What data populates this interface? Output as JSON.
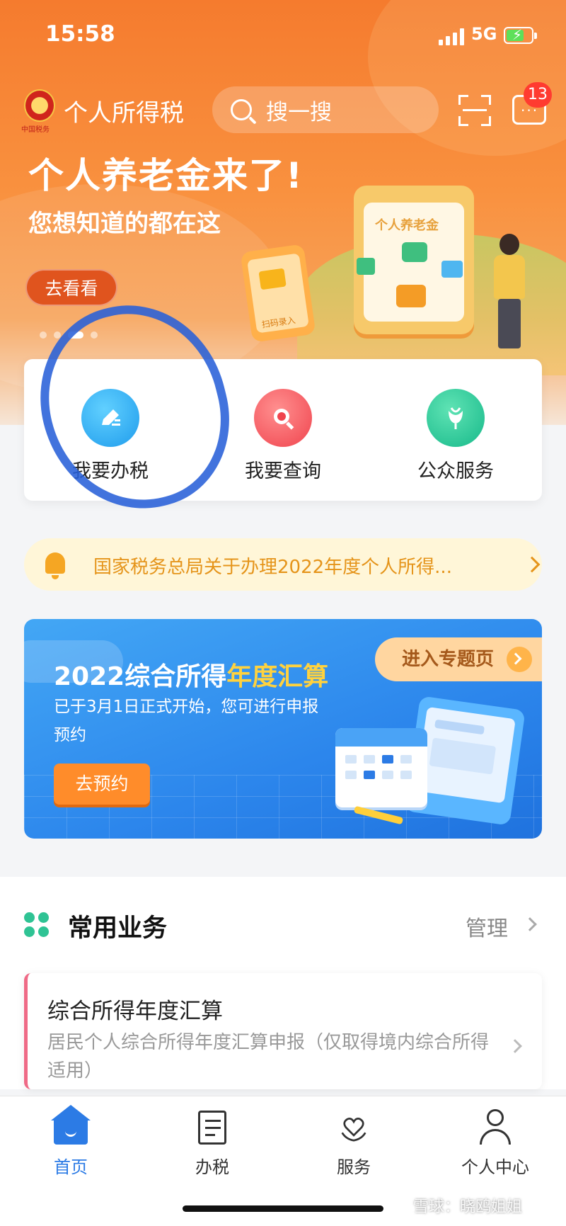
{
  "status_bar": {
    "time": "15:58",
    "network": "5G"
  },
  "header": {
    "emblem_text": "中国税务",
    "app_title": "个人所得税",
    "search_placeholder": "搜一搜",
    "message_badge": "13"
  },
  "banner": {
    "headline": "个人养老金来了!",
    "subheadline": "您想知道的都在这",
    "button_label": "去看看",
    "card_label": "个人养老金",
    "phone_label": "扫码录入"
  },
  "quick_actions": [
    {
      "label": "我要办税",
      "icon": "pencil-icon",
      "color": "#1f9cec"
    },
    {
      "label": "我要查询",
      "icon": "search-icon",
      "color": "#f0444e"
    },
    {
      "label": "公众服务",
      "icon": "tulip-icon",
      "color": "#17b98a"
    }
  ],
  "notice": {
    "text": "国家税务总局关于办理2022年度个人所得..."
  },
  "promo": {
    "title_main": "2022综合所得",
    "title_highlight": "年度汇算",
    "description": "已于3月1日正式开始，您可进行申报预约",
    "button_label": "去预约",
    "entry_label": "进入专题页"
  },
  "common_business": {
    "title": "常用业务",
    "manage_label": "管理",
    "items": [
      {
        "title": "综合所得年度汇算",
        "description": "居民个人综合所得年度汇算申报（仅取得境内综合所得适用）"
      }
    ]
  },
  "tabbar": {
    "tabs": [
      {
        "label": "首页",
        "icon": "home-icon",
        "active": true
      },
      {
        "label": "办税",
        "icon": "document-edit-icon",
        "active": false
      },
      {
        "label": "服务",
        "icon": "heart-hands-icon",
        "active": false
      },
      {
        "label": "个人中心",
        "icon": "user-icon",
        "active": false
      }
    ]
  },
  "watermark": "雪球：晓鸥姐姐",
  "colors": {
    "primary": "#2c7be5",
    "hero_orange": "#f57b2e",
    "notice_text": "#e5941a"
  }
}
